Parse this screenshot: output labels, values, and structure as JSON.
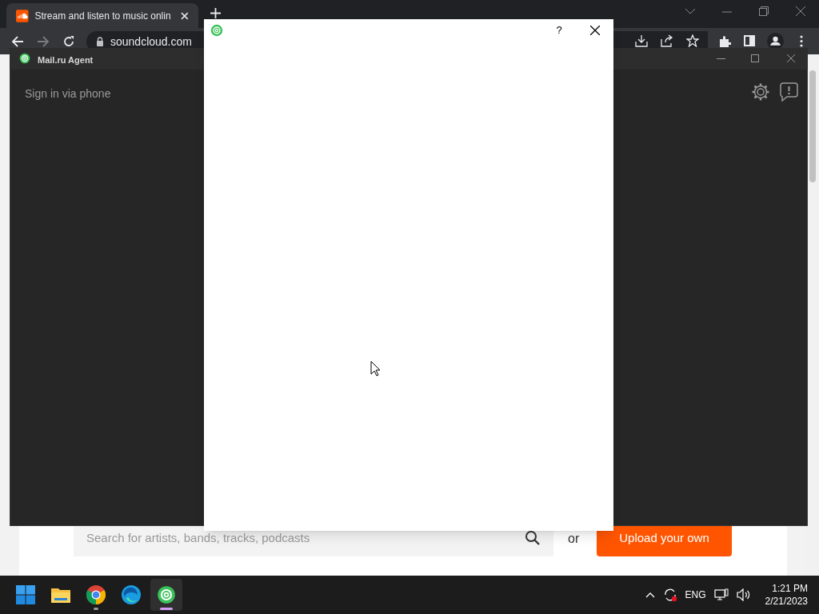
{
  "browser": {
    "tab": {
      "title": "Stream and listen to music onlin",
      "selected": true
    },
    "url": "soundcloud.com"
  },
  "page": {
    "search": {
      "placeholder": "Search for artists, bands, tracks, podcasts"
    },
    "or_text": "or",
    "upload_button": "Upload your own"
  },
  "agent_window": {
    "title": "Mail.ru Agent",
    "sign_in_link": "Sign in via phone"
  },
  "dialog": {
    "help_button": "?"
  },
  "taskbar": {
    "apps": [
      {
        "kind": "start",
        "selected": false,
        "running": false
      },
      {
        "kind": "folder",
        "selected": false,
        "running": false
      },
      {
        "kind": "chrome",
        "selected": false,
        "running": true
      },
      {
        "kind": "edge",
        "selected": false,
        "running": false
      },
      {
        "kind": "agent",
        "selected": true,
        "running": true
      }
    ],
    "language": "ENG",
    "time": "1:21 PM",
    "date": "2/21/2023"
  }
}
